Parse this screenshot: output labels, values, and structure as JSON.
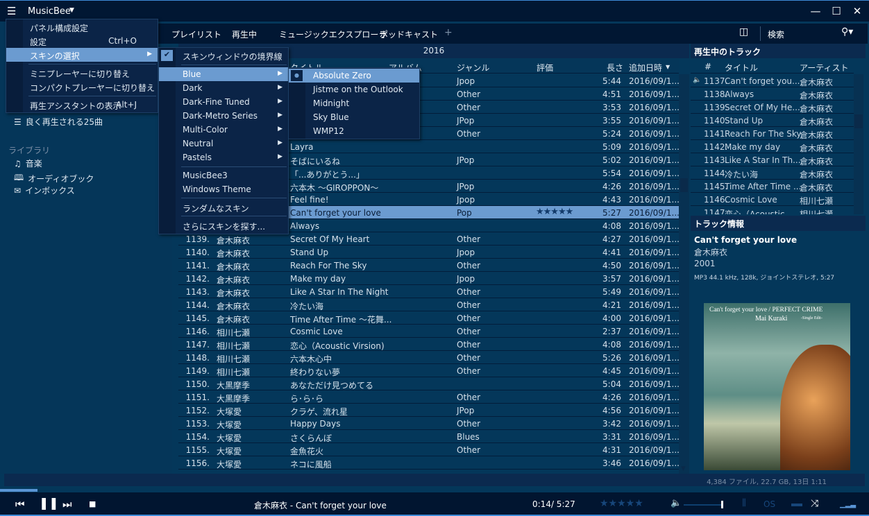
{
  "app": {
    "title": "MusicBee"
  },
  "window": {
    "minimize": "—",
    "maximize": "☐",
    "close": "✕"
  },
  "tabs": [
    "プレイリスト",
    "再生中",
    "ミュージックエクスプローラ",
    "ポッドキャスト",
    "+"
  ],
  "search": {
    "label": "検索"
  },
  "sidebar": {
    "playlist_item": "良く再生される25曲",
    "library_header": "ライブラリ",
    "library": [
      "音楽",
      "オーディオブック",
      "インボックス"
    ]
  },
  "group_header": "2016",
  "columns": {
    "title": "タイトル",
    "album": "アルバム",
    "genre": "ジャンル",
    "rating": "評価",
    "length": "長さ",
    "date_added": "追加日時"
  },
  "tracks": [
    {
      "num": "",
      "artist": "",
      "title": "",
      "genre": "Jpop",
      "rating": 0,
      "length": "5:44",
      "date": "2016/09/1..."
    },
    {
      "num": "",
      "artist": "",
      "title": "",
      "genre": "Other",
      "rating": 0,
      "length": "4:51",
      "date": "2016/09/1..."
    },
    {
      "num": "",
      "artist": "",
      "title": "",
      "genre": "Other",
      "rating": 0,
      "length": "3:53",
      "date": "2016/09/1..."
    },
    {
      "num": "",
      "artist": "",
      "title": "",
      "genre": "JPop",
      "rating": 0,
      "length": "3:55",
      "date": "2016/09/1..."
    },
    {
      "num": "",
      "artist": "",
      "title": "",
      "genre": "Other",
      "rating": 0,
      "length": "5:24",
      "date": "2016/09/1..."
    },
    {
      "num": "",
      "artist": "",
      "title": "Layra",
      "genre": "",
      "rating": 0,
      "length": "5:09",
      "date": "2016/09/1..."
    },
    {
      "num": "",
      "artist": "",
      "title": "そばにいるね",
      "genre": "JPop",
      "rating": 0,
      "length": "5:02",
      "date": "2016/09/1..."
    },
    {
      "num": "",
      "artist": "",
      "title": "「...ありがとう...」",
      "genre": "",
      "rating": 0,
      "length": "5:54",
      "date": "2016/09/1..."
    },
    {
      "num": "",
      "artist": "",
      "title": "六本木 〜GIROPPON〜",
      "genre": "JPop",
      "rating": 0,
      "length": "4:26",
      "date": "2016/09/1..."
    },
    {
      "num": "",
      "artist": "",
      "title": "Feel fine!",
      "genre": "Jpop",
      "rating": 0,
      "length": "4:43",
      "date": "2016/09/1..."
    },
    {
      "num": "",
      "artist": "",
      "title": "Can't forget your love",
      "genre": "Pop",
      "rating": 5,
      "length": "5:27",
      "date": "2016/09/1...",
      "selected": true
    },
    {
      "num": "",
      "artist": "",
      "title": "Always",
      "genre": "",
      "rating": 0,
      "length": "4:08",
      "date": "2016/09/1..."
    },
    {
      "num": "1139.",
      "artist": "倉木麻衣",
      "title": "Secret Of My Heart",
      "genre": "Other",
      "rating": 0,
      "length": "4:27",
      "date": "2016/09/1..."
    },
    {
      "num": "1140.",
      "artist": "倉木麻衣",
      "title": "Stand Up",
      "genre": "Jpop",
      "rating": 0,
      "length": "4:41",
      "date": "2016/09/1..."
    },
    {
      "num": "1141.",
      "artist": "倉木麻衣",
      "title": "Reach For The Sky",
      "genre": "Other",
      "rating": 0,
      "length": "4:50",
      "date": "2016/09/1..."
    },
    {
      "num": "1142.",
      "artist": "倉木麻衣",
      "title": "Make my day",
      "genre": "Jpop",
      "rating": 0,
      "length": "3:57",
      "date": "2016/09/1..."
    },
    {
      "num": "1143.",
      "artist": "倉木麻衣",
      "title": "Like A Star In The Night",
      "genre": "Other",
      "rating": 0,
      "length": "5:49",
      "date": "2016/09/1..."
    },
    {
      "num": "1144.",
      "artist": "倉木麻衣",
      "title": "冷たい海",
      "genre": "Other",
      "rating": 0,
      "length": "4:21",
      "date": "2016/09/1..."
    },
    {
      "num": "1145.",
      "artist": "倉木麻衣",
      "title": "Time After Time 〜花舞...",
      "genre": "Other",
      "rating": 0,
      "length": "4:00",
      "date": "2016/09/1..."
    },
    {
      "num": "1146.",
      "artist": "相川七瀬",
      "title": "Cosmic Love",
      "genre": "Other",
      "rating": 0,
      "length": "2:37",
      "date": "2016/09/1..."
    },
    {
      "num": "1147.",
      "artist": "相川七瀬",
      "title": "恋心（Acoustic Virsion)",
      "genre": "Other",
      "rating": 0,
      "length": "4:08",
      "date": "2016/09/1..."
    },
    {
      "num": "1148.",
      "artist": "相川七瀬",
      "title": "六本木心中",
      "genre": "Other",
      "rating": 0,
      "length": "5:26",
      "date": "2016/09/1..."
    },
    {
      "num": "1149.",
      "artist": "相川七瀬",
      "title": "終わりない夢",
      "genre": "Other",
      "rating": 0,
      "length": "4:45",
      "date": "2016/09/1..."
    },
    {
      "num": "1150.",
      "artist": "大黒摩季",
      "title": "あなただけ見つめてる",
      "genre": "",
      "rating": 0,
      "length": "5:04",
      "date": "2016/09/1..."
    },
    {
      "num": "1151.",
      "artist": "大黒摩季",
      "title": "ら･ら･ら",
      "genre": "Other",
      "rating": 0,
      "length": "4:26",
      "date": "2016/09/1..."
    },
    {
      "num": "1152.",
      "artist": "大塚愛",
      "title": "クラゲ、流れ星",
      "genre": "JPop",
      "rating": 0,
      "length": "4:56",
      "date": "2016/09/1..."
    },
    {
      "num": "1153.",
      "artist": "大塚愛",
      "title": "Happy Days",
      "genre": "Other",
      "rating": 0,
      "length": "3:42",
      "date": "2016/09/1..."
    },
    {
      "num": "1154.",
      "artist": "大塚愛",
      "title": "さくらんぼ",
      "genre": "Blues",
      "rating": 0,
      "length": "3:31",
      "date": "2016/09/1..."
    },
    {
      "num": "1155.",
      "artist": "大塚愛",
      "title": "金魚花火",
      "genre": "Other",
      "rating": 0,
      "length": "4:31",
      "date": "2016/09/1..."
    },
    {
      "num": "1156.",
      "artist": "大塚愛",
      "title": "ネコに風船",
      "genre": "",
      "rating": 0,
      "length": "3:46",
      "date": "2016/09/1..."
    }
  ],
  "now_playing": {
    "header": "再生中のトラック",
    "columns": {
      "num": "#",
      "title": "タイトル",
      "artist": "アーティスト"
    },
    "rows": [
      {
        "num": "1137.",
        "title": "Can't forget you...",
        "artist": "倉木麻衣",
        "playing": true
      },
      {
        "num": "1138.",
        "title": "Always",
        "artist": "倉木麻衣"
      },
      {
        "num": "1139.",
        "title": "Secret Of My He...",
        "artist": "倉木麻衣"
      },
      {
        "num": "1140.",
        "title": "Stand Up",
        "artist": "倉木麻衣"
      },
      {
        "num": "1141.",
        "title": "Reach For The Sky",
        "artist": "倉木麻衣"
      },
      {
        "num": "1142.",
        "title": "Make my day",
        "artist": "倉木麻衣"
      },
      {
        "num": "1143.",
        "title": "Like A Star In Th...",
        "artist": "倉木麻衣"
      },
      {
        "num": "1144.",
        "title": "冷たい海",
        "artist": "倉木麻衣"
      },
      {
        "num": "1145.",
        "title": "Time After Time ...",
        "artist": "倉木麻衣"
      },
      {
        "num": "1146.",
        "title": "Cosmic Love",
        "artist": "相川七瀬"
      },
      {
        "num": "1147.",
        "title": "恋心（Acoustic...",
        "artist": "相川七瀬"
      }
    ]
  },
  "track_info": {
    "header": "トラック情報",
    "title": "Can't forget your love",
    "artist": "倉木麻衣",
    "year": "2001",
    "format": "MP3 44.1 kHz, 128k, ジョイントステレオ, 5:27",
    "album_art": {
      "line1": "Can't forget your love / PERFECT CRIME",
      "line2": "Mai Kuraki",
      "line3": "-Single Edit-"
    }
  },
  "status": "4,384 ファイル, 22.7 GB, 13日 1:11",
  "player": {
    "now_playing": "倉木麻衣 - Can't forget your love",
    "time": "0:14/ 5:27",
    "progress_percent": 4.3,
    "rating": 0
  },
  "menu_main": {
    "items": [
      {
        "label": "パネル構成設定",
        "shortcut": ""
      },
      {
        "label": "設定",
        "shortcut": "Ctrl+O"
      },
      {
        "label": "スキンの選択",
        "shortcut": "",
        "submenu": true
      },
      {
        "label": "ミニプレーヤーに切り替え",
        "shortcut": ""
      },
      {
        "label": "コンパクトプレーヤーに切り替え",
        "shortcut": ""
      },
      {
        "label": "再生アシスタントの表示",
        "shortcut": "Alt+J"
      }
    ]
  },
  "menu_skin": {
    "border_option": "スキンウィンドウの境界線",
    "groups": [
      "Blue",
      "Dark",
      "Dark-Fine Tuned",
      "Dark-Metro Series",
      "Multi-Color",
      "Neutral",
      "Pastels"
    ],
    "others": [
      "MusicBee3",
      "Windows Theme"
    ],
    "random": "ランダムなスキン",
    "more": "さらにスキンを探す..."
  },
  "menu_blue": {
    "items": [
      "Absolute Zero",
      "Jistme on the Outlook",
      "Midnight",
      "Sky Blue",
      "WMP12"
    ],
    "selected": "Absolute Zero"
  },
  "colors": {
    "accent": "#6b9bd0",
    "background": "#04375a",
    "titlebar": "#011733"
  }
}
